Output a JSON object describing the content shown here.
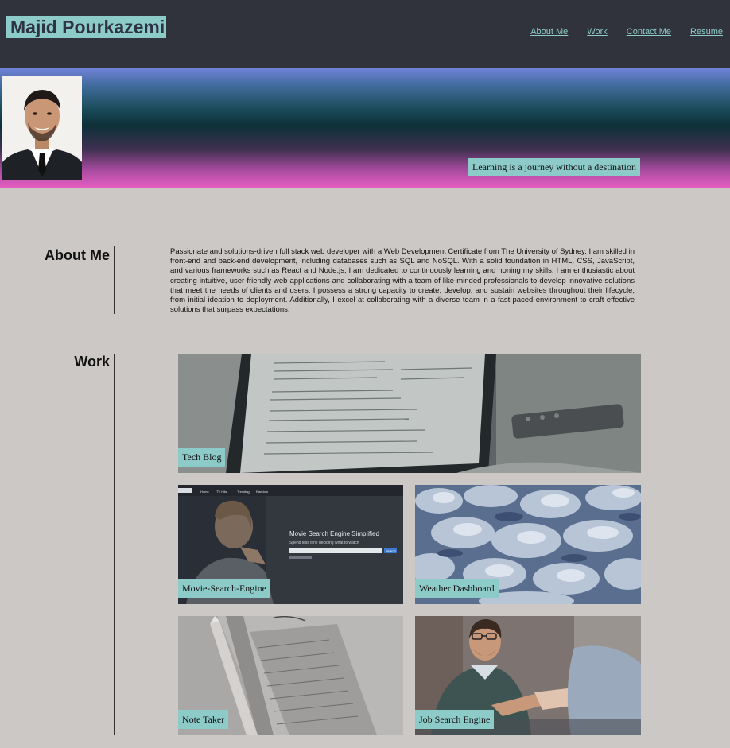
{
  "header": {
    "title": "Majid Pourkazemi",
    "nav": [
      {
        "label": "About Me"
      },
      {
        "label": "Work"
      },
      {
        "label": "Contact Me"
      },
      {
        "label": "Resume"
      }
    ]
  },
  "hero": {
    "tagline": "Learning is a journey without a destination"
  },
  "about": {
    "heading": "About Me",
    "text": "Passionate and solutions-driven full stack web developer with a Web Development Certificate from The University of Sydney. I am skilled in front-end and back-end development, including databases such as SQL and NoSQL. With a solid foundation in HTML, CSS, JavaScript, and various frameworks such as React and Node.js, I am dedicated to continuously learning and honing my skills. I am enthusiastic about creating intuitive, user-friendly web applications and collaborating with a team of like-minded professionals to develop innovative solutions that meet the needs of clients and users. I possess a strong capacity to create, develop, and sustain websites throughout their lifecycle, from initial ideation to deployment. Additionally, I excel at collaborating with a diverse team in a fast-paced environment to craft effective solutions that surpass expectations."
  },
  "work": {
    "heading": "Work",
    "projects": [
      {
        "label": "Tech Blog"
      },
      {
        "label": "Movie-Search-Engine",
        "screenshot_headline": "Movie Search Engine Simplified",
        "screenshot_subline": "Spend less time deciding what to watch",
        "screenshot_button": "Search",
        "screenshot_nav": [
          "Home",
          "TV Hits",
          "Trending",
          "Random"
        ]
      },
      {
        "label": "Weather Dashboard"
      },
      {
        "label": "Note Taker"
      },
      {
        "label": "Job Search Engine"
      }
    ]
  },
  "colors": {
    "header_bg": "#31333c",
    "accent": "#8dcbc9",
    "page_bg": "#cbc8c5"
  }
}
